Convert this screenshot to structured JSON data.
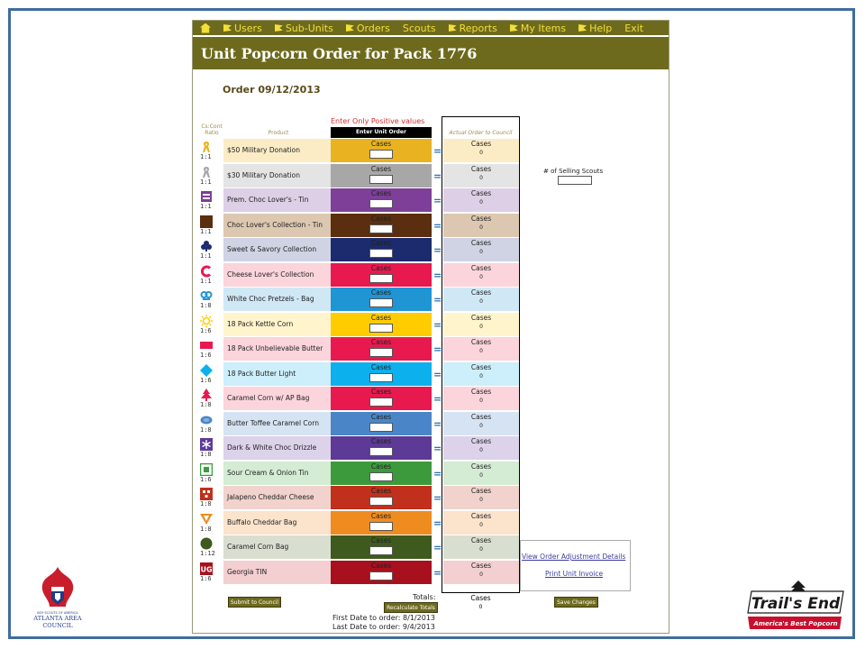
{
  "nav": {
    "home_icon": "home-icon",
    "items": [
      "Users",
      "Sub-Units",
      "Orders",
      "Scouts",
      "Reports",
      "My Items",
      "Help",
      "Exit"
    ]
  },
  "title": "Unit Popcorn Order for Pack 1776",
  "order_date": "Order 09/12/2013",
  "headers": {
    "ratio": "Cs:Cont Ratio",
    "product": "Product",
    "positive": "Enter Only Positive values",
    "enter": "Enter Unit Order",
    "actual": "Actual Order to Council"
  },
  "cases_label": "Cases",
  "products": [
    {
      "ratio": "1:1",
      "name": "$50 Military Donation",
      "color": "#e9b220",
      "light": "#fbecc5",
      "icon": "ribbon-icon",
      "actual": "0"
    },
    {
      "ratio": "1:1",
      "name": "$30 Military Donation",
      "color": "#a7a7a7",
      "light": "#e4e4e4",
      "icon": "ribbon-icon",
      "actual": "0"
    },
    {
      "ratio": "1:1",
      "name": "Prem. Choc Lover's - Tin",
      "color": "#7d3f98",
      "light": "#dccfe6",
      "icon": "tin-icon",
      "actual": "0"
    },
    {
      "ratio": "1:1",
      "name": "Choc Lover's Collection - Tin",
      "color": "#5a2e0e",
      "light": "#dcc7b0",
      "icon": "moon-icon",
      "actual": "0"
    },
    {
      "ratio": "1:1",
      "name": "Sweet & Savory Collection",
      "color": "#1c2a6e",
      "light": "#cfd3e4",
      "icon": "club-icon",
      "actual": "0"
    },
    {
      "ratio": "1:1",
      "name": "Cheese Lover's Collection",
      "color": "#e8194f",
      "light": "#fbd4dc",
      "icon": "c-letter-icon",
      "actual": "0"
    },
    {
      "ratio": "1:8",
      "name": "White Choc Pretzels - Bag",
      "color": "#1f95d4",
      "light": "#d0e8f6",
      "icon": "pretzel-icon",
      "actual": "0"
    },
    {
      "ratio": "1:6",
      "name": "18 Pack Kettle Corn",
      "color": "#ffcc00",
      "light": "#fff4cc",
      "icon": "sun-icon",
      "actual": "0"
    },
    {
      "ratio": "1:6",
      "name": "18 Pack Unbelievable Butter",
      "color": "#e8194f",
      "light": "#fbd4dc",
      "icon": "rectangle-icon",
      "actual": "0"
    },
    {
      "ratio": "1:6",
      "name": "18 Pack Butter Light",
      "color": "#0cb0ec",
      "light": "#cdeefb",
      "icon": "diamond-icon",
      "actual": "0"
    },
    {
      "ratio": "1:8",
      "name": "Caramel Corn w/ AP Bag",
      "color": "#e8194f",
      "light": "#fbd4dc",
      "icon": "tree-icon",
      "actual": "0"
    },
    {
      "ratio": "1:8",
      "name": "Butter Toffee Caramel Corn",
      "color": "#4a86c7",
      "light": "#d6e3f3",
      "icon": "oval-icon",
      "actual": "0"
    },
    {
      "ratio": "1:8",
      "name": "Dark & White Choc Drizzle",
      "color": "#5c3a96",
      "light": "#dcd2ea",
      "icon": "asterisk-icon",
      "actual": "0"
    },
    {
      "ratio": "1:6",
      "name": "Sour Cream & Onion Tin",
      "color": "#3c9a3c",
      "light": "#d4ebd4",
      "icon": "square-icon",
      "actual": "0"
    },
    {
      "ratio": "1:8",
      "name": "Jalapeno Cheddar Cheese",
      "color": "#c0301c",
      "light": "#f1d2cc",
      "icon": "checker-icon",
      "actual": "0"
    },
    {
      "ratio": "1:8",
      "name": "Buffalo Cheddar Bag",
      "color": "#ef8c20",
      "light": "#fbe3cc",
      "icon": "triangle-icon",
      "actual": "0"
    },
    {
      "ratio": "1:12",
      "name": "Caramel Corn Bag",
      "color": "#3e5a1e",
      "light": "#d9dfd0",
      "icon": "circle-icon",
      "actual": "0"
    },
    {
      "ratio": "1:6",
      "name": "Georgia TIN",
      "color": "#a8101e",
      "light": "#f4cfd2",
      "icon": "ug-icon",
      "actual": "0"
    }
  ],
  "selling_scouts_label": "# of Selling Scouts",
  "links": {
    "adjust": "View Order Adjustment Details",
    "invoice": "Print Unit Invoice"
  },
  "buttons": {
    "submit": "Submit to Council",
    "recalc": "Recalculate Totals",
    "save": "Save Changes"
  },
  "totals": {
    "label": "Totals:",
    "cases": "Cases",
    "value": "0"
  },
  "dates": {
    "first": "First Date to order: 8/1/2013",
    "last": "Last Date to order: 9/4/2013"
  },
  "bsa_logo": {
    "line1": "BOY SCOUTS OF AMERICA",
    "line2": "ATLANTA AREA",
    "line3": "COUNCIL"
  },
  "te_logo": {
    "brand": "Trail's End",
    "tagline": "America's Best Popcorn"
  }
}
